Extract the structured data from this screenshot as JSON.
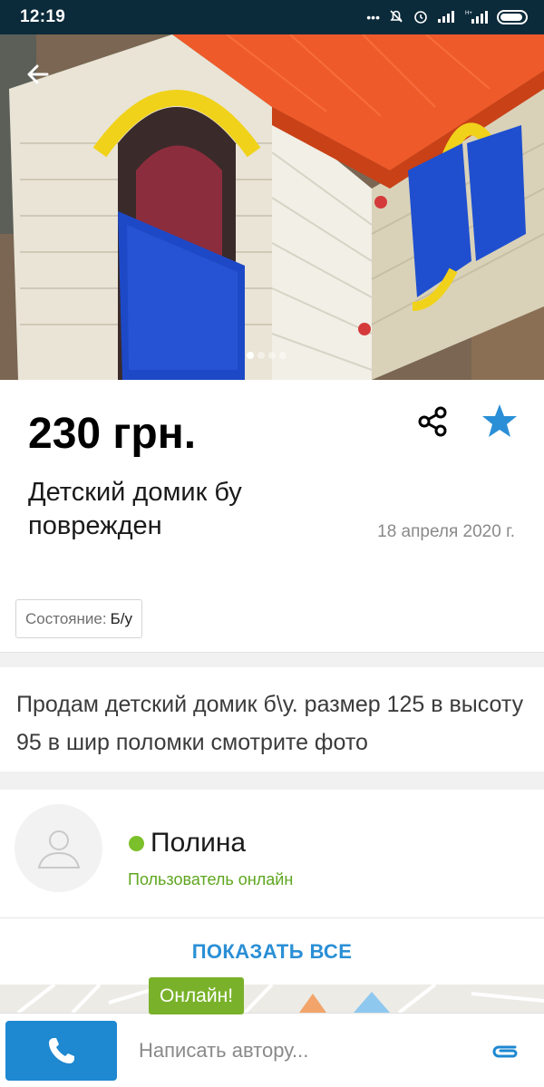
{
  "status_bar": {
    "time": "12:19",
    "icons": [
      "signal-dots-icon",
      "mute-icon",
      "alarm-icon",
      "signal-icon",
      "signal-h-plus-icon",
      "battery-icon"
    ]
  },
  "header": {
    "back_icon": "arrow-left-icon"
  },
  "gallery": {
    "image_count": 4,
    "active_index": 0
  },
  "listing": {
    "price": "230 грн.",
    "title": "Детский домик бу поврежден",
    "date": "18 апреля 2020 г.",
    "share_icon": "share-icon",
    "favorite_icon": "star-icon",
    "accent_color": "#2a8fd6",
    "params": [
      {
        "label": "Состояние:",
        "value": "Б/у"
      }
    ]
  },
  "description": {
    "text": "Продам детский домик б\\у. размер 125 в высоту 95 в шир поломки смотрите фото"
  },
  "seller": {
    "name": "Полина",
    "status": "Пользователь онлайн",
    "online_color": "#7bbf2a",
    "avatar_icon": "user-placeholder-icon"
  },
  "actions": {
    "show_all": "ПОКАЗАТЬ ВСЕ",
    "online_tag": "Онлайн!"
  },
  "bottom_bar": {
    "call_icon": "phone-icon",
    "message_placeholder": "Написать автору...",
    "attach_icon": "paperclip-icon",
    "call_color": "#1e88d1"
  }
}
